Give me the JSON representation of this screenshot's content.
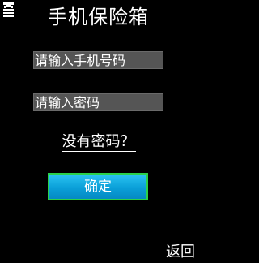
{
  "header": {
    "status_icon": "signal-bars-icon",
    "title": "手机保险箱"
  },
  "form": {
    "phone_placeholder": "请输入手机号码",
    "phone_value": "",
    "password_placeholder": "请输入密码",
    "password_value": "",
    "forgot_link": "没有密码？",
    "confirm_label": "确定"
  },
  "softkeys": {
    "right_label": "返回"
  },
  "colors": {
    "background": "#000000",
    "field_background": "#555555",
    "button_blue": "#0a9fd8",
    "button_border_green": "#2bd14a",
    "text": "#ffffff"
  }
}
